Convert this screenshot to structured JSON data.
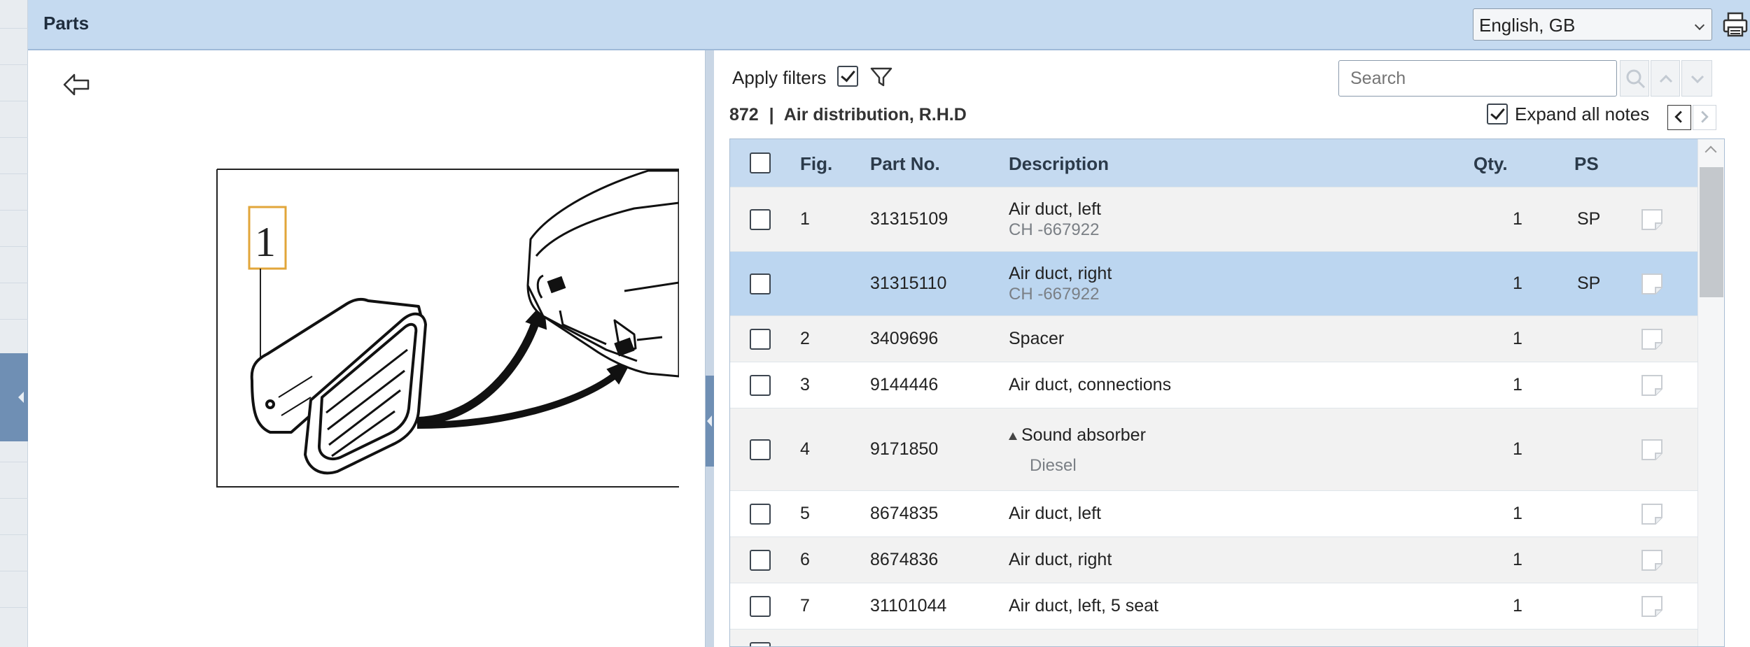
{
  "header": {
    "title": "Parts",
    "language": "English, GB"
  },
  "toolbar": {
    "apply_filters_label": "Apply filters",
    "apply_filters_checked": true,
    "search_placeholder": "Search",
    "expand_notes_label": "Expand all notes",
    "expand_notes_checked": true
  },
  "breadcrumb": {
    "section_no": "872",
    "separator": "|",
    "section_name": "Air distribution, R.H.D"
  },
  "illustration": {
    "callout": "1"
  },
  "table": {
    "columns": {
      "fig": "Fig.",
      "part_no": "Part No.",
      "description": "Description",
      "qty": "Qty.",
      "ps": "PS"
    },
    "rows": [
      {
        "fig": "1",
        "part_no": "31315109",
        "description": "Air duct, left",
        "note": "CH -667922",
        "qty": "1",
        "ps": "SP"
      },
      {
        "fig": "",
        "part_no": "31315110",
        "description": "Air duct, right",
        "note": "CH -667922",
        "qty": "1",
        "ps": "SP",
        "selected": true
      },
      {
        "fig": "2",
        "part_no": "3409696",
        "description": "Spacer",
        "note": "",
        "qty": "1",
        "ps": ""
      },
      {
        "fig": "3",
        "part_no": "9144446",
        "description": "Air duct, connections",
        "note": "",
        "qty": "1",
        "ps": ""
      },
      {
        "fig": "4",
        "part_no": "9171850",
        "description": "Sound absorber",
        "note": "Diesel",
        "qty": "1",
        "ps": "",
        "expandable": true
      },
      {
        "fig": "5",
        "part_no": "8674835",
        "description": "Air duct, left",
        "note": "",
        "qty": "1",
        "ps": ""
      },
      {
        "fig": "6",
        "part_no": "8674836",
        "description": "Air duct, right",
        "note": "",
        "qty": "1",
        "ps": ""
      },
      {
        "fig": "7",
        "part_no": "31101044",
        "description": "Air duct, left, 5 seat",
        "note": "",
        "qty": "1",
        "ps": ""
      }
    ]
  },
  "colors": {
    "header_bg": "#c5daf0",
    "selected_row": "#bcd6f0",
    "accent_blue": "#6f8fb4"
  },
  "icons": [
    "print-icon",
    "back-arrow-icon",
    "filter-icon",
    "search-icon",
    "chevron-up-icon",
    "chevron-down-icon",
    "chevron-left-icon",
    "chevron-right-icon",
    "note-icon"
  ]
}
